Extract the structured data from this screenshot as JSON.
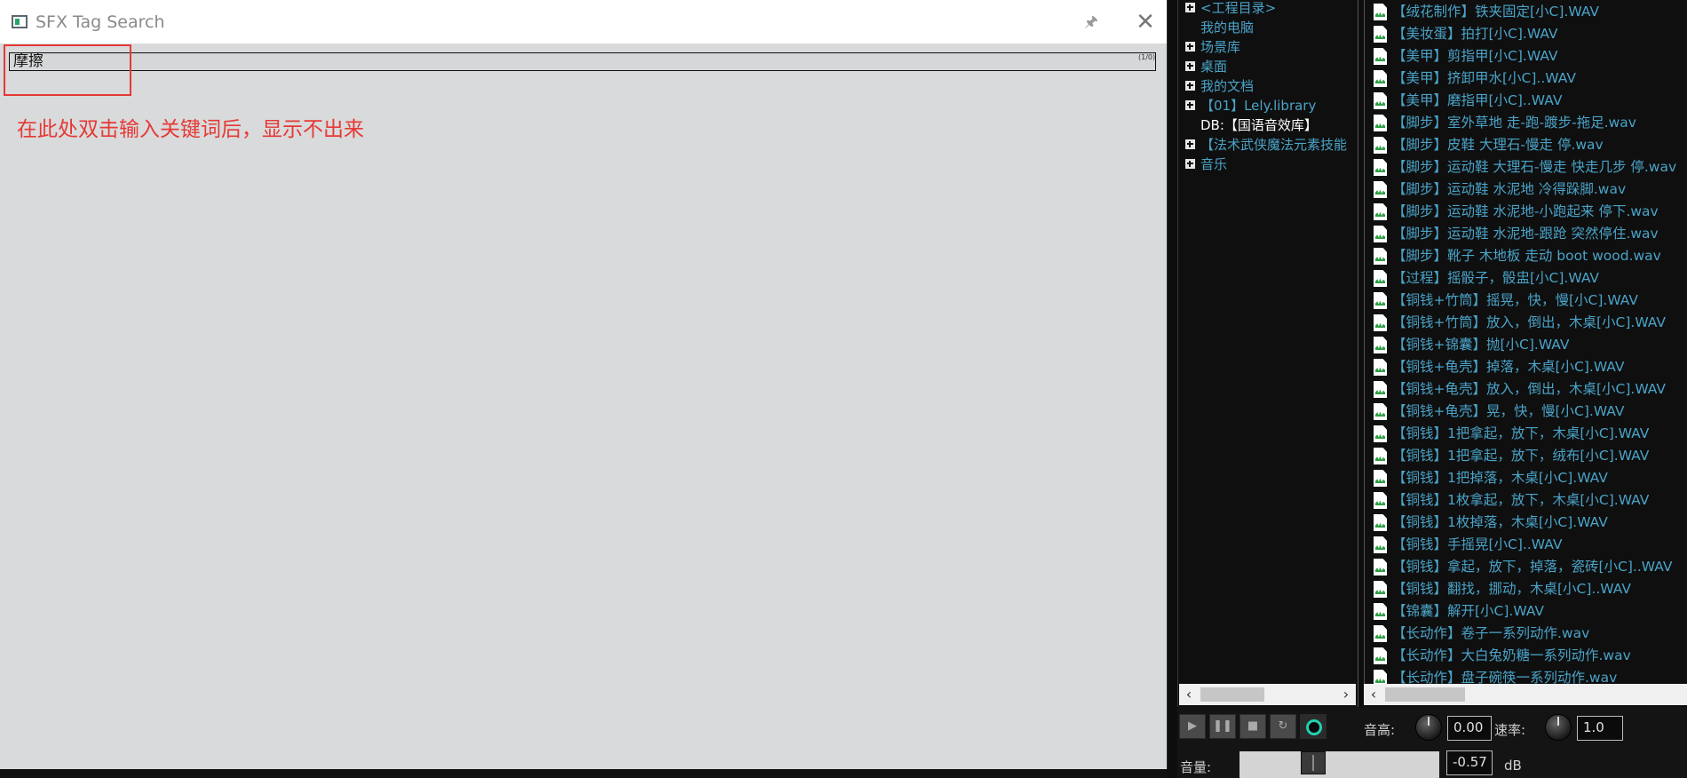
{
  "window": {
    "title": "SFX Tag Search",
    "pin_icon": "pin-icon",
    "close_icon": "close-icon"
  },
  "search": {
    "value": "摩擦",
    "counter": "(1/0)"
  },
  "annotation": {
    "text": "在此处双击输入关键词后，显示不出来",
    "color": "#e53935"
  },
  "tree": {
    "items": [
      {
        "label": "<工程目录>",
        "expandable": true
      },
      {
        "label": "我的电脑",
        "expandable": false
      },
      {
        "label": "场景库",
        "expandable": true
      },
      {
        "label": "桌面",
        "expandable": true
      },
      {
        "label": "我的文档",
        "expandable": true
      },
      {
        "label": "【01】Lely.library",
        "expandable": true
      },
      {
        "label": "DB:【国语音效库】",
        "expandable": false,
        "db": true
      },
      {
        "label": "【法术武侠魔法元素技能",
        "expandable": true
      },
      {
        "label": "音乐",
        "expandable": true
      }
    ]
  },
  "files": [
    "【绒花制作】铁夹固定[小C].WAV",
    "【美妆蛋】拍打[小C].WAV",
    "【美甲】剪指甲[小C].WAV",
    "【美甲】挤卸甲水[小C]..WAV",
    "【美甲】磨指甲[小C]..WAV",
    "【脚步】室外草地 走-跑-踱步-拖足.wav",
    "【脚步】皮鞋 大理石-慢走 停.wav",
    "【脚步】运动鞋 大理石-慢走 快走几步 停.wav",
    "【脚步】运动鞋 水泥地 冷得跺脚.wav",
    "【脚步】运动鞋 水泥地-小跑起来 停下.wav",
    "【脚步】运动鞋 水泥地-跟跄 突然停住.wav",
    "【脚步】靴子 木地板 走动 boot wood.wav",
    "【过程】摇骰子，骰盅[小C].WAV",
    "【铜钱+竹筒】摇晃，快，慢[小C].WAV",
    "【铜钱+竹筒】放入，倒出，木桌[小C].WAV",
    "【铜钱+锦囊】抛[小C].WAV",
    "【铜钱+龟壳】掉落，木桌[小C].WAV",
    "【铜钱+龟壳】放入，倒出，木桌[小C].WAV",
    "【铜钱+龟壳】晃，快，慢[小C].WAV",
    "【铜钱】1把拿起，放下，木桌[小C].WAV",
    "【铜钱】1把拿起，放下，绒布[小C].WAV",
    "【铜钱】1把掉落，木桌[小C].WAV",
    "【铜钱】1枚拿起，放下，木桌[小C].WAV",
    "【铜钱】1枚掉落，木桌[小C].WAV",
    "【铜钱】手摇晃[小C]..WAV",
    "【铜钱】拿起，放下，掉落，瓷砖[小C]..WAV",
    "【铜钱】翻找，挪动，木桌[小C]..WAV",
    "【锦囊】解开[小C].WAV",
    "【长动作】卷子一系列动作.wav",
    "【长动作】大白兔奶糖一系列动作.wav",
    "【长动作】盘子碗筷一系列动作.wav"
  ],
  "controls": {
    "play_icon": "play-icon",
    "pause_icon": "pause-icon",
    "stop_icon": "stop-icon",
    "loop_icon": "loop-icon",
    "record_icon": "record-icon",
    "pitch_label": "音高:",
    "pitch_value": "0.00",
    "speed_label": "速率:",
    "speed_value": "1.0",
    "volume_label": "音量:",
    "volume_value": "-0.57",
    "volume_unit": "dB"
  }
}
